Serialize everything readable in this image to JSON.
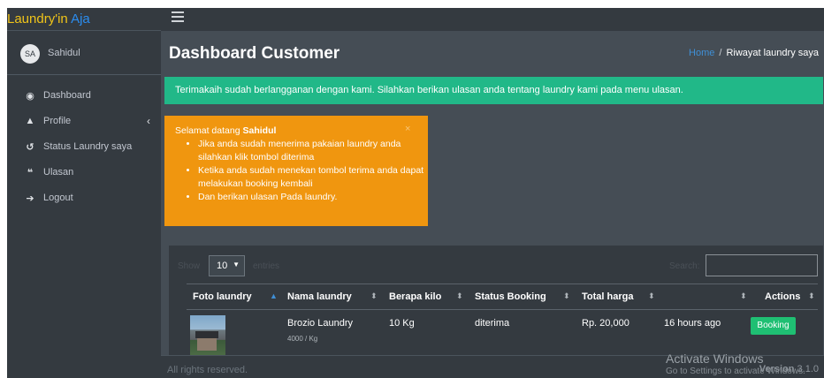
{
  "brand": {
    "part1": "Laundry'in",
    "part2": "Aja"
  },
  "user": {
    "initials": "SA",
    "name": "Sahidul"
  },
  "sidebar": {
    "items": [
      {
        "icon": "tachometer-icon",
        "glyph": "◉",
        "label": "Dashboard"
      },
      {
        "icon": "user-icon",
        "glyph": "▲",
        "label": "Profile",
        "caret": "‹"
      },
      {
        "icon": "history-icon",
        "glyph": "↺",
        "label": "Status Laundry saya"
      },
      {
        "icon": "quote-icon",
        "glyph": "❝",
        "label": "Ulasan"
      },
      {
        "icon": "sign-out-icon",
        "glyph": "➔",
        "label": "Logout"
      }
    ]
  },
  "header": {
    "title": "Dashboard Customer",
    "breadcrumb": {
      "home": "Home",
      "separator": "/",
      "current": "Riwayat laundry saya"
    }
  },
  "alerts": {
    "success": "Terimakaih sudah berlangganan dengan kami. Silahkan berikan ulasan anda tentang laundry kami pada menu ulasan.",
    "warning": {
      "greeting": "Selamat datang",
      "name": "Sahidul",
      "close": "×",
      "items": [
        "Jika anda sudah menerima pakaian laundry anda silahkan klik tombol diterima",
        "Ketika anda sudah menekan tombol terima anda dapat melakukan booking kembali",
        "Dan berikan ulasan Pada laundry."
      ]
    }
  },
  "table": {
    "length_label": "Show",
    "length_value": "10",
    "entries_label": "entries",
    "search_label": "Search:",
    "search_value": "",
    "columns": [
      "Foto laundry",
      "Nama laundry",
      "Berapa kilo",
      "Status Booking",
      "Total harga",
      "",
      "Actions"
    ],
    "rows": [
      {
        "nama": "Brozio Laundry",
        "harga_per_kg": "4000 / Kg",
        "kilo": "10 Kg",
        "status": "diterima",
        "total": "Rp. 20,000",
        "waktu": "16 hours ago",
        "action": "Booking"
      }
    ]
  },
  "footer": {
    "rights": "All rights reserved.",
    "version_label": "Version",
    "version_value": "3.1.0"
  },
  "watermark": {
    "title": "Activate Windows",
    "subtitle": "Go to Settings to activate Windows."
  },
  "colors": {
    "success": "#21b888",
    "warning": "#f0960f",
    "sidebar": "#343a40",
    "content": "#454d55",
    "button": "#1fbf73",
    "link": "#3f8fd6"
  }
}
